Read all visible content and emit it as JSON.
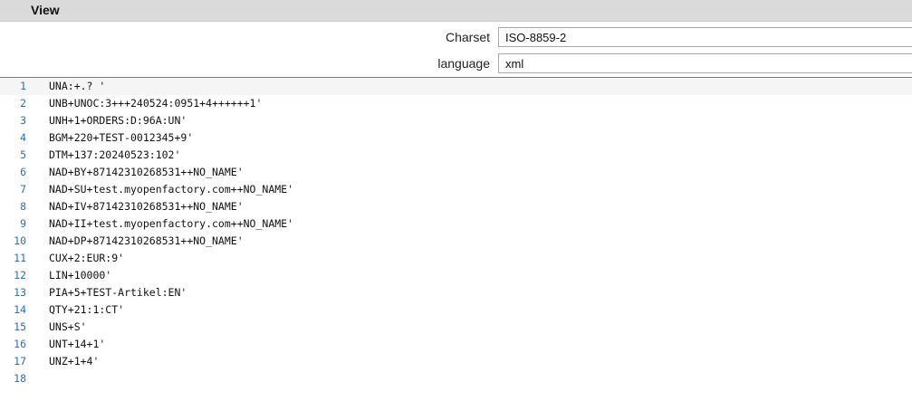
{
  "header": {
    "title": "View"
  },
  "fields": {
    "charset": {
      "label": "Charset",
      "value": "ISO-8859-2"
    },
    "language": {
      "label": "language",
      "value": "xml"
    }
  },
  "editor": {
    "lines": [
      {
        "number": "1",
        "text": "UNA:+.? '"
      },
      {
        "number": "2",
        "text": "UNB+UNOC:3+++240524:0951+4++++++1'"
      },
      {
        "number": "3",
        "text": "UNH+1+ORDERS:D:96A:UN'"
      },
      {
        "number": "4",
        "text": "BGM+220+TEST-0012345+9'"
      },
      {
        "number": "5",
        "text": "DTM+137:20240523:102'"
      },
      {
        "number": "6",
        "text": "NAD+BY+87142310268531++NO_NAME'"
      },
      {
        "number": "7",
        "text": "NAD+SU+test.myopenfactory.com++NO_NAME'"
      },
      {
        "number": "8",
        "text": "NAD+IV+87142310268531++NO_NAME'"
      },
      {
        "number": "9",
        "text": "NAD+II+test.myopenfactory.com++NO_NAME'"
      },
      {
        "number": "10",
        "text": "NAD+DP+87142310268531++NO_NAME'"
      },
      {
        "number": "11",
        "text": "CUX+2:EUR:9'"
      },
      {
        "number": "12",
        "text": "LIN+10000'"
      },
      {
        "number": "13",
        "text": "PIA+5+TEST-Artikel:EN'"
      },
      {
        "number": "14",
        "text": "QTY+21:1:CT'"
      },
      {
        "number": "15",
        "text": "UNS+S'"
      },
      {
        "number": "16",
        "text": "UNT+14+1'"
      },
      {
        "number": "17",
        "text": "UNZ+1+4'"
      },
      {
        "number": "18",
        "text": ""
      }
    ]
  }
}
